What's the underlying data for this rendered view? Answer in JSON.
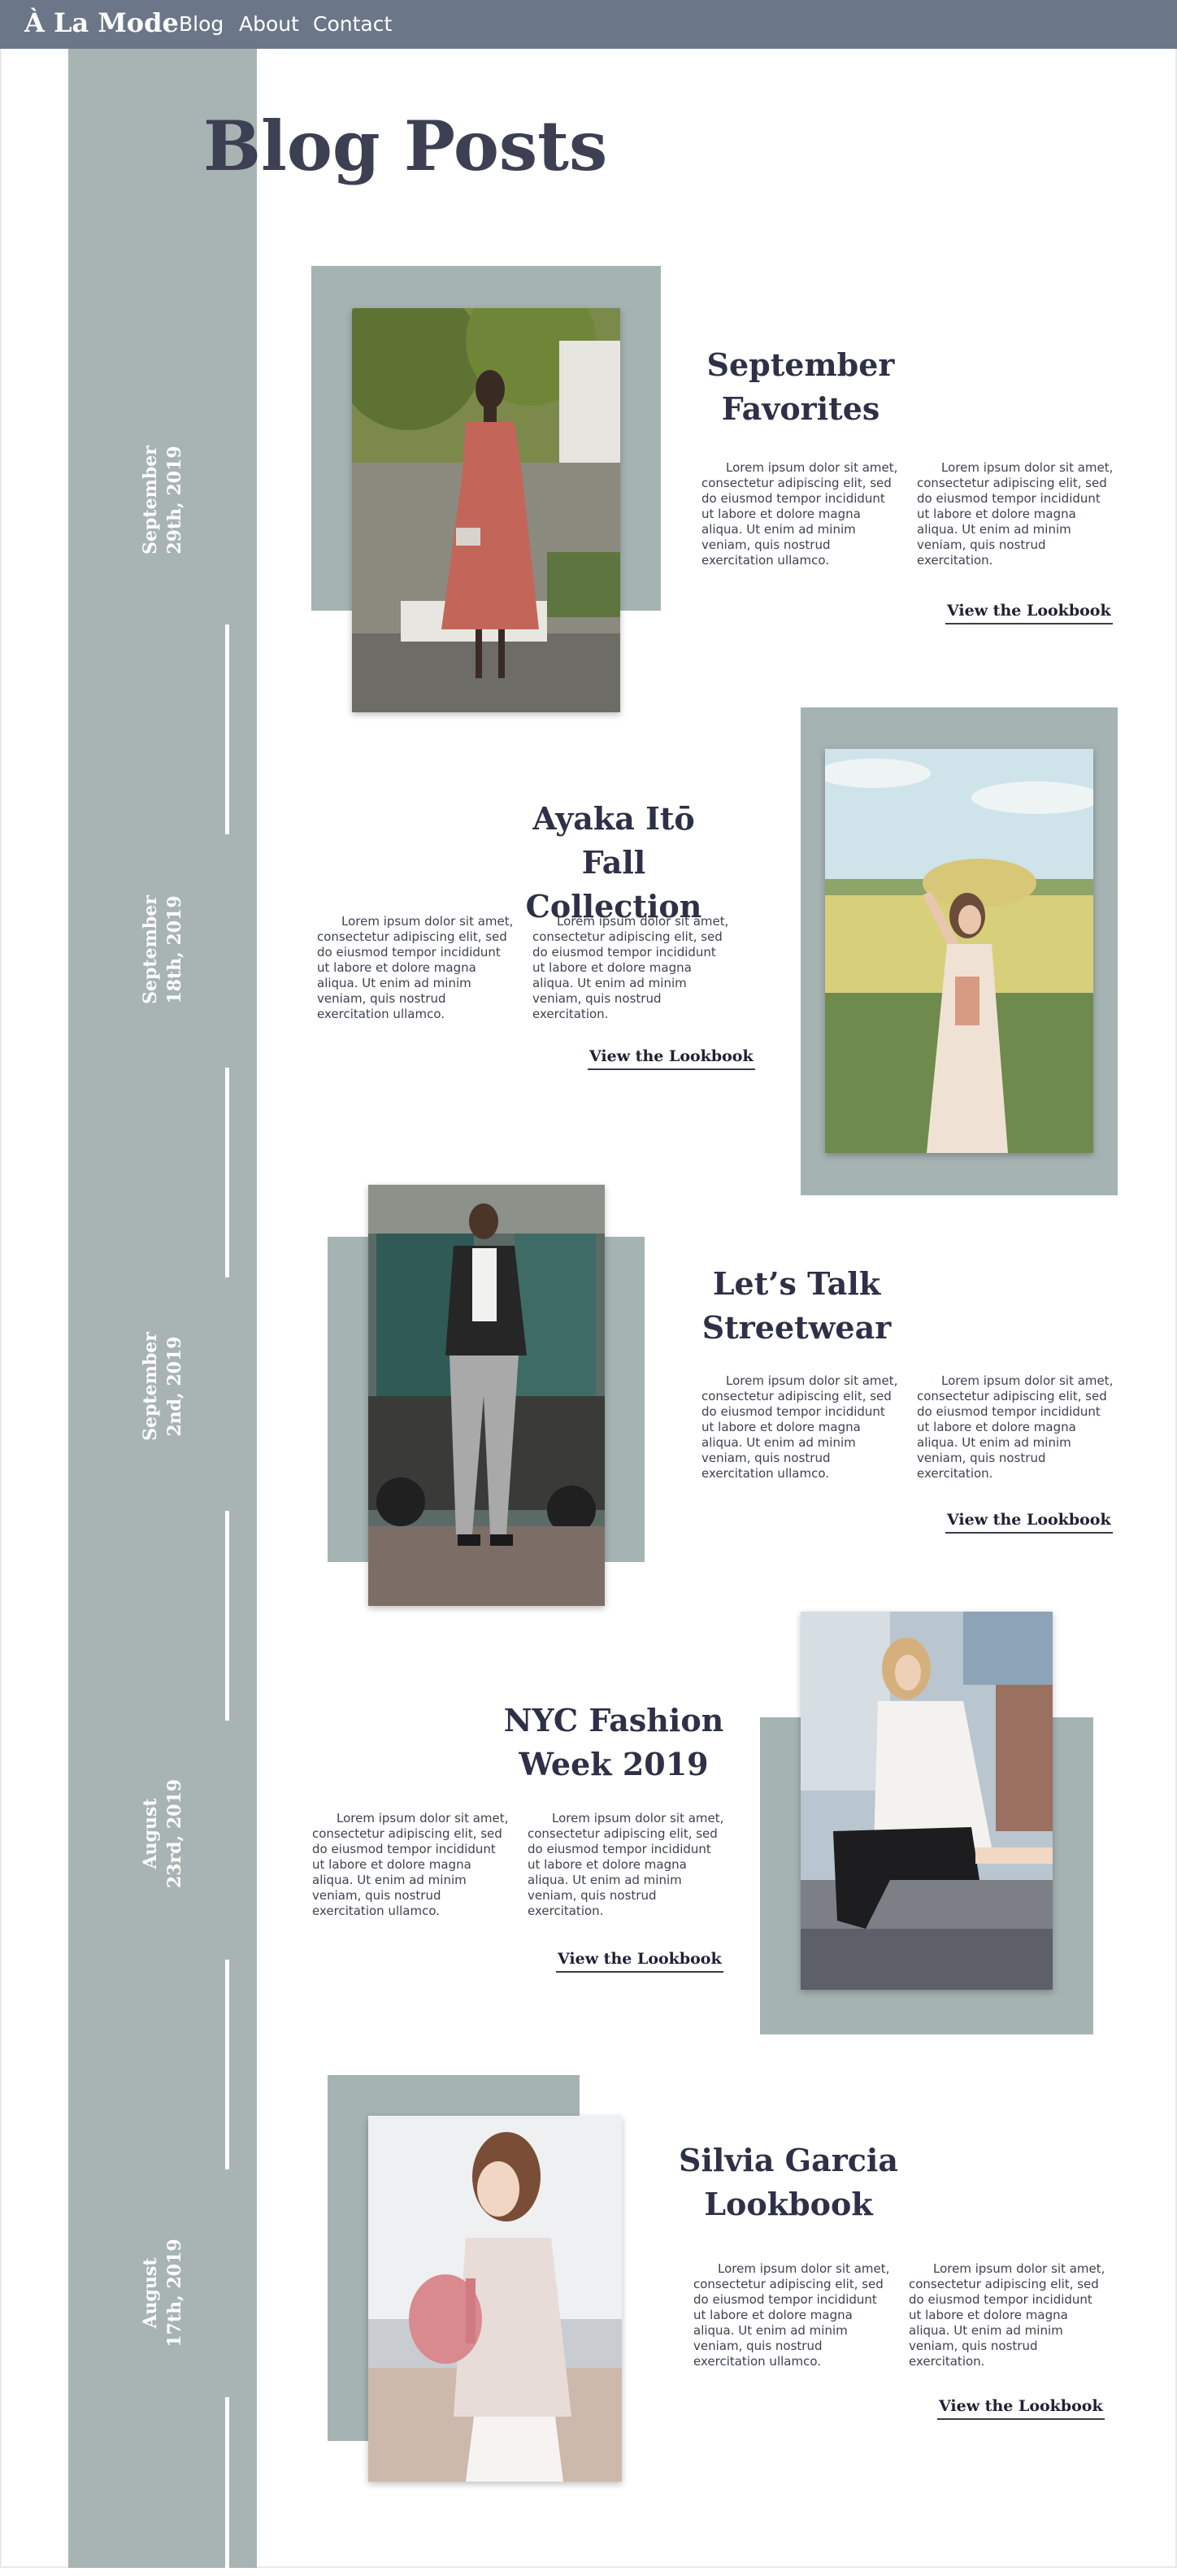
{
  "header": {
    "brand": "À La Mode",
    "nav": [
      "Blog",
      "About",
      "Contact"
    ]
  },
  "page_title": "Blog Posts",
  "colors": {
    "topbar": "#6b7788",
    "timeline": "#a8b4b4",
    "accent_block": "#a6b3b3",
    "title_text": "#3d3f52"
  },
  "posts": [
    {
      "date_line1": "September",
      "date_line2": "29th, 2019",
      "title_line1": "September",
      "title_line2": "Favorites",
      "text": "Lorem ipsum dolor sit amet, consectetur adipiscing elit, sed do eiusmod tempor incididunt ut labore et dolore magna aliqua. Ut enim ad minim veniam, quis nostrud exercitation ullamco.",
      "text2": "Lorem ipsum dolor sit amet, consectetur adipiscing elit, sed do eiusmod tempor incididunt ut labore et dolore magna aliqua. Ut enim ad minim veniam, quis nostrud exercitation.",
      "cta": "View the Lookbook",
      "photo": "woman in long rose dress in a garden"
    },
    {
      "date_line1": "September",
      "date_line2": "18th, 2019",
      "title_line1": "Ayaka Itō",
      "title_line2": "Fall Collection",
      "text": "Lorem ipsum dolor sit amet, consectetur adipiscing elit, sed do eiusmod tempor incididunt ut labore et dolore magna aliqua. Ut enim ad minim veniam, quis nostrud exercitation ullamco.",
      "text2": "Lorem ipsum dolor sit amet, consectetur adipiscing elit, sed do eiusmod tempor incididunt ut labore et dolore magna aliqua. Ut enim ad minim veniam, quis nostrud exercitation.",
      "cta": "View the Lookbook",
      "photo": "woman with flower crown in a rapeseed field"
    },
    {
      "date_line1": "September",
      "date_line2": "2nd, 2019",
      "title_line1": "Let’s Talk",
      "title_line2": "Streetwear",
      "text": "Lorem ipsum dolor sit amet, consectetur adipiscing elit, sed do eiusmod tempor incididunt ut labore et dolore magna aliqua. Ut enim ad minim veniam, quis nostrud exercitation ullamco.",
      "text2": "Lorem ipsum dolor sit amet, consectetur adipiscing elit, sed do eiusmod tempor incididunt ut labore et dolore magna aliqua. Ut enim ad minim veniam, quis nostrud exercitation.",
      "cta": "View the Lookbook",
      "photo": "man in leather jacket and grey trousers on a street"
    },
    {
      "date_line1": "August",
      "date_line2": "23rd, 2019",
      "title_line1": "NYC Fashion",
      "title_line2": "Week 2019",
      "text": "Lorem ipsum dolor sit amet, consectetur adipiscing elit, sed do eiusmod tempor incididunt ut labore et dolore magna aliqua. Ut enim ad minim veniam, quis nostrud exercitation ullamco.",
      "text2": "Lorem ipsum dolor sit amet, consectetur adipiscing elit, sed do eiusmod tempor incididunt ut labore et dolore magna aliqua. Ut enim ad minim veniam, quis nostrud exercitation.",
      "cta": "View the Lookbook",
      "photo": "woman in white shirt seated on a ledge"
    },
    {
      "date_line1": "August",
      "date_line2": "17th, 2019",
      "title_line1": "Silvia Garcia",
      "title_line2": "Lookbook",
      "text": "Lorem ipsum dolor sit amet, consectetur adipiscing elit, sed do eiusmod tempor incididunt ut labore et dolore magna aliqua. Ut enim ad minim veniam, quis nostrud exercitation ullamco.",
      "text2": "Lorem ipsum dolor sit amet, consectetur adipiscing elit, sed do eiusmod tempor incididunt ut labore et dolore magna aliqua. Ut enim ad minim veniam, quis nostrud exercitation.",
      "cta": "View the Lookbook",
      "photo": "woman with pink backpack outdoors"
    }
  ]
}
